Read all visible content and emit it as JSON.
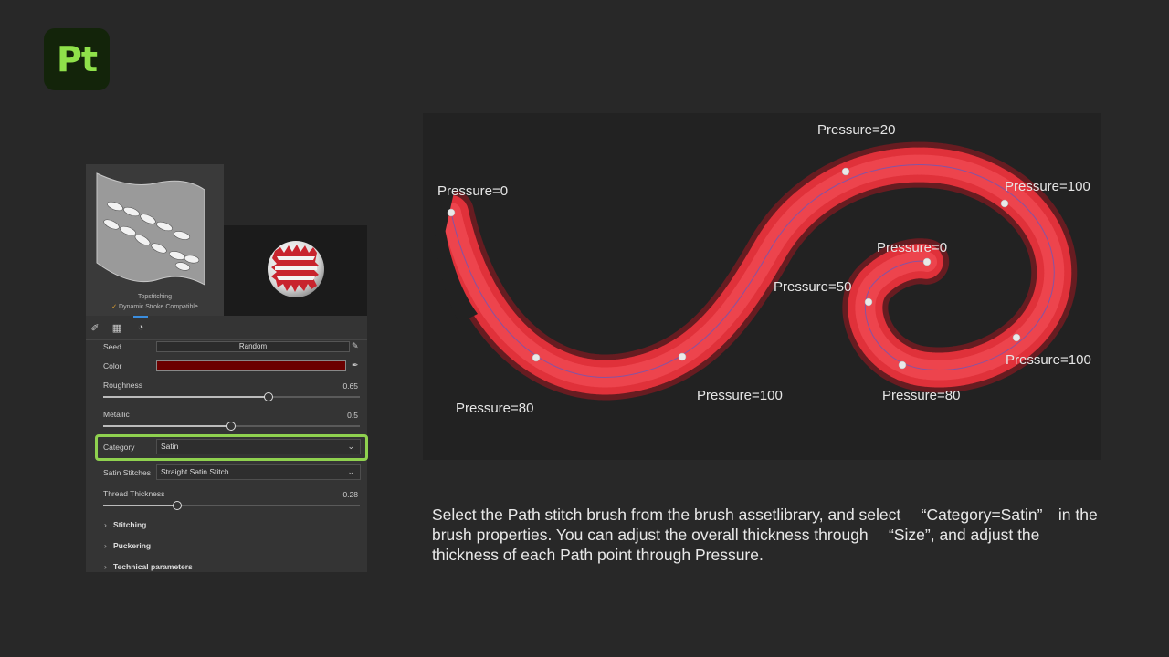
{
  "app": {
    "logo_text": "Pt",
    "accent": "#8fe14a"
  },
  "brush_preview": {
    "name": "Topstitching",
    "badge": "Dynamic Stroke Compatible"
  },
  "properties": {
    "seed": {
      "label": "Seed",
      "value": "Random"
    },
    "color": {
      "label": "Color",
      "value": "#6b0000"
    },
    "roughness": {
      "label": "Roughness",
      "value": "0.65",
      "fraction": 0.65
    },
    "metallic": {
      "label": "Metallic",
      "value": "0.5",
      "fraction": 0.5
    },
    "category": {
      "label": "Category",
      "value": "Satin"
    },
    "satin_stitches": {
      "label": "Satin Stitches",
      "value": "Straight Satin Stitch"
    },
    "thread_thickness": {
      "label": "Thread Thickness",
      "value": "0.28",
      "fraction": 0.28
    },
    "groups": [
      "Stitching",
      "Puckering",
      "Technical parameters"
    ]
  },
  "pressure_labels": [
    "Pressure=0",
    "Pressure=20",
    "Pressure=100",
    "Pressure=0",
    "Pressure=50",
    "Pressure=100",
    "Pressure=80",
    "Pressure=100",
    "Pressure=80"
  ],
  "description": "Select the Path stitch brush from the brush assetlibrary, and select 　“Category=Satin”　in the brush properties. You can adjust the overall thickness through 　“Size”, and adjust the thickness of each Path point through Pressure.",
  "stitch_color": "#e0313a",
  "highlight_color": "#8fd14f"
}
